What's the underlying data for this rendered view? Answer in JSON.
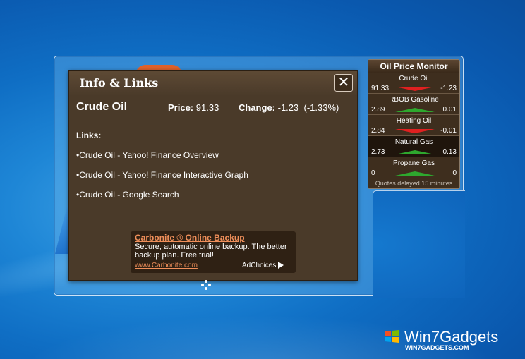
{
  "flyout": {
    "title": "Info & Links",
    "close_label": "✕",
    "quote": {
      "symbol": "Crude Oil",
      "price_label": "Price:",
      "price_value": "91.33",
      "change_label": "Change:",
      "change_value": "-1.23",
      "change_percent": "(-1.33%)"
    },
    "links_label": "Links:",
    "links": [
      "Crude Oil - Yahoo! Finance Overview",
      "Crude Oil - Yahoo! Finance Interactive Graph",
      "Crude Oil - Google Search"
    ],
    "ad": {
      "title": "Carbonite ® Online Backup",
      "body": "Secure, automatic online backup. The better backup plan. Free trial!",
      "url": "www.Carbonite.com",
      "adchoices": "AdChoices"
    }
  },
  "gadget": {
    "title": "Oil Price Monitor",
    "rows": [
      {
        "name": "Crude Oil",
        "price": "91.33",
        "change": "-1.23",
        "direction": "down"
      },
      {
        "name": "RBOB Gasoline",
        "price": "2.89",
        "change": "0.01",
        "direction": "up"
      },
      {
        "name": "Heating Oil",
        "price": "2.84",
        "change": "-0.01",
        "direction": "down"
      },
      {
        "name": "Natural Gas",
        "price": "2.73",
        "change": "0.13",
        "direction": "up"
      },
      {
        "name": "Propane Gas",
        "price": "0",
        "change": "0",
        "direction": "up"
      }
    ],
    "footer": "Quotes delayed 15 minutes"
  },
  "brand": {
    "name": "Win7Gadgets",
    "url": "WIN7GADGETS.COM"
  },
  "colors": {
    "down": "#e02020",
    "up": "#2ea82e",
    "link_orange": "#f08f5a"
  }
}
